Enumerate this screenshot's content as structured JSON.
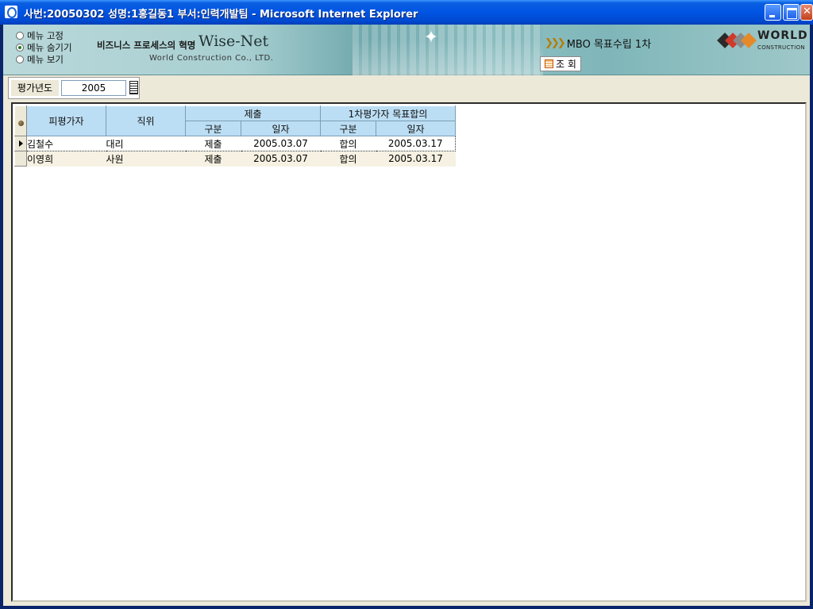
{
  "window": {
    "title": "사번:20050302 성명:1홍길동1 부서:인력개발팀 - Microsoft Internet Explorer"
  },
  "menu_options": [
    {
      "label": "메뉴 고정",
      "selected": false
    },
    {
      "label": "메뉴 숨기기",
      "selected": true
    },
    {
      "label": "메뉴 보기",
      "selected": false
    }
  ],
  "brand": {
    "slogan": "비즈니스 프로세스의 혁명",
    "name": "Wise-Net",
    "company": "World Construction Co., LTD."
  },
  "program": {
    "label": "MBO 목표수립 1차",
    "query_button": "조 회"
  },
  "logo": {
    "word": "WORLD",
    "sub": "CONSTRUCTION",
    "colors": [
      "#d13a2a",
      "#2a2a2a",
      "#8a8a8a",
      "#e58a2a"
    ]
  },
  "filter": {
    "year_label": "평가년도",
    "year_value": "2005"
  },
  "grid": {
    "headers": {
      "evaluatee": "피평가자",
      "position": "직위",
      "submission_group": "제출",
      "agreement_group": "1차평가자 목표합의",
      "type": "구분",
      "date": "일자"
    },
    "rows": [
      {
        "name": "김철수",
        "position": "대리",
        "sub_type": "제출",
        "sub_date": "2005.03.07",
        "agr_type": "합의",
        "agr_date": "2005.03.17"
      },
      {
        "name": "이영희",
        "position": "사원",
        "sub_type": "제출",
        "sub_date": "2005.03.07",
        "agr_type": "합의",
        "agr_date": "2005.03.17"
      }
    ]
  }
}
